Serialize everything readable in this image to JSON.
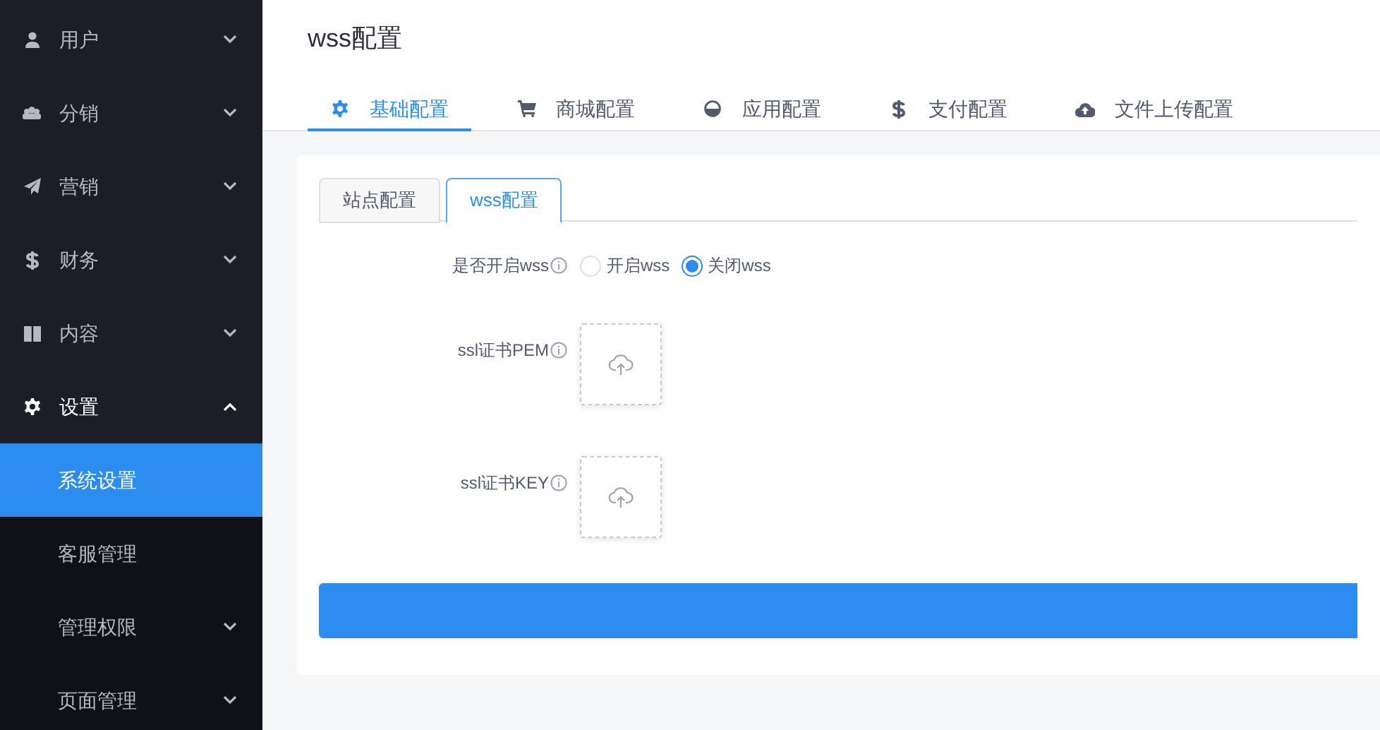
{
  "sidebar": {
    "items": [
      {
        "label": "用户",
        "kind": "user",
        "expanded": false
      },
      {
        "label": "分销",
        "kind": "group",
        "expanded": false
      },
      {
        "label": "营销",
        "kind": "send",
        "expanded": false
      },
      {
        "label": "财务",
        "kind": "dollar",
        "expanded": false
      },
      {
        "label": "内容",
        "kind": "book",
        "expanded": false
      },
      {
        "label": "设置",
        "kind": "gear",
        "expanded": true,
        "children": [
          {
            "label": "系统设置",
            "kind": "link",
            "selected": true
          },
          {
            "label": "客服管理",
            "kind": "link",
            "selected": false
          },
          {
            "label": "管理权限",
            "kind": "group",
            "selected": false,
            "expanded": false
          },
          {
            "label": "页面管理",
            "kind": "group",
            "selected": false,
            "expanded": false
          }
        ]
      }
    ]
  },
  "page": {
    "title": "wss配置",
    "tabs": [
      {
        "label": "基础配置",
        "kind": "gear",
        "selected": true
      },
      {
        "label": "商城配置",
        "kind": "cart",
        "selected": false
      },
      {
        "label": "应用配置",
        "kind": "halfcircle",
        "selected": false
      },
      {
        "label": "支付配置",
        "kind": "dollar",
        "selected": false
      },
      {
        "label": "文件上传配置",
        "kind": "cloud",
        "selected": false
      }
    ]
  },
  "card": {
    "tabs": [
      {
        "label": "站点配置",
        "selected": false
      },
      {
        "label": "wss配置",
        "selected": true
      }
    ],
    "fields": [
      {
        "kind": "radio",
        "label": "是否开启wss",
        "options": [
          {
            "label": "开启wss",
            "selected": false
          },
          {
            "label": "关闭wss",
            "selected": true
          }
        ]
      },
      {
        "kind": "upload",
        "label": "ssl证书PEM"
      },
      {
        "kind": "upload",
        "label": "ssl证书KEY"
      }
    ]
  }
}
